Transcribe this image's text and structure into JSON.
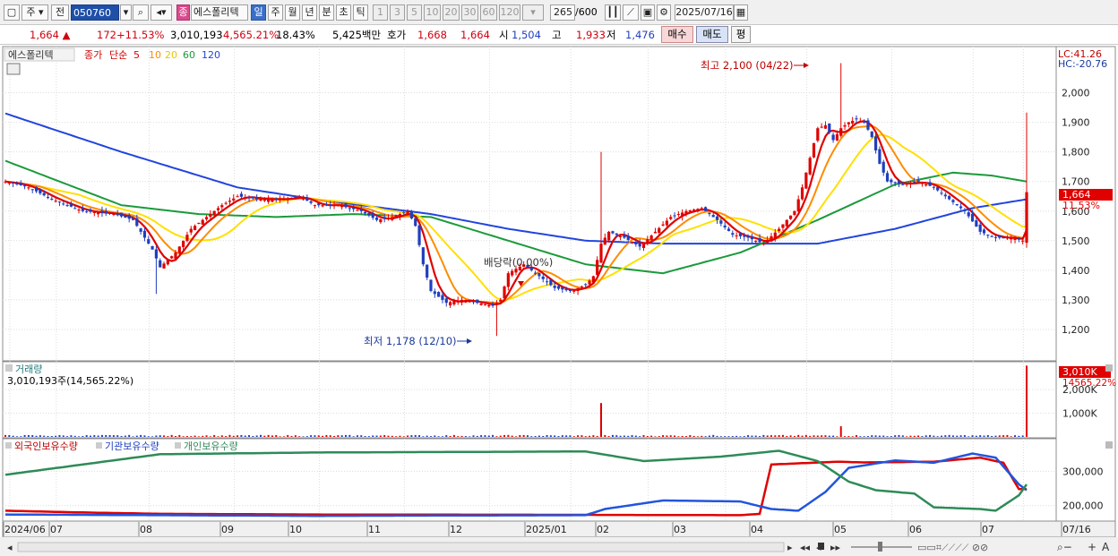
{
  "toolbar": {
    "market_btn": "주",
    "prev_btn": "전",
    "code": "050760",
    "badge": "종",
    "stock_name": "에스폴리텍",
    "periods": [
      "일",
      "주",
      "월",
      "년",
      "분",
      "초",
      "틱"
    ],
    "active_period": "일",
    "counts": [
      "1",
      "3",
      "5",
      "10",
      "20",
      "30",
      "60",
      "120"
    ],
    "bars_shown": "265",
    "bars_total": "/600",
    "date": "2025/07/16"
  },
  "quote": {
    "price": "1,664",
    "change": "172",
    "change_pct": "+11.53%",
    "volume": "3,010,193",
    "vol_ratio": "4,565.21%",
    "turnover": "18.43%",
    "trade_value": "5,425백만",
    "hoga_label": "호가",
    "ask": "1,668",
    "bid": "1,664",
    "open_label": "시",
    "open": "1,504",
    "high_label": "고",
    "high": "1,933",
    "low_label": "저",
    "low": "1,476",
    "buy_btn": "매수",
    "sell_btn": "매도",
    "eval_btn": "평"
  },
  "colors": {
    "ma5": "#e00000",
    "ma10": "#ff8c00",
    "ma20": "#ffe000",
    "ma60": "#1a9a3a",
    "ma120": "#2244dd",
    "up": "#e00000",
    "down": "#1f3fbf",
    "foreign": "#e00000",
    "institution": "#2255dd",
    "individual": "#2e8b57"
  },
  "chart_data": [
    {
      "type": "candlestick",
      "title": "에스폴리텍",
      "legend": {
        "price_label": "종가",
        "method_label": "단순",
        "periods": [
          "5",
          "10",
          "20",
          "60",
          "120"
        ]
      },
      "ylim": [
        1100,
        2150
      ],
      "yticks": [
        "1,200",
        "1,300",
        "1,400",
        "1,500",
        "1,600",
        "1,700",
        "1,800",
        "1,900",
        "2,000"
      ],
      "right_labels": {
        "lc": "LC:41.26",
        "hc": "HC:-20.76",
        "last_price": "1,664",
        "last_pct": "11.53%"
      },
      "annotations": {
        "high": "최고 2,100 (04/22)",
        "low": "최저 1,178 (12/10)",
        "dividend": "배당락(0.00%)"
      },
      "x_labels": [
        "2024/06",
        "07",
        "08",
        "09",
        "10",
        "11",
        "12",
        "2025/01",
        "02",
        "03",
        "04",
        "05",
        "06",
        "07",
        "07/16"
      ],
      "close_anchors": [
        [
          0,
          1700
        ],
        [
          6,
          1680
        ],
        [
          12,
          1640
        ],
        [
          20,
          1600
        ],
        [
          28,
          1590
        ],
        [
          33,
          1570
        ],
        [
          38,
          1470
        ],
        [
          40,
          1410
        ],
        [
          44,
          1460
        ],
        [
          48,
          1540
        ],
        [
          52,
          1580
        ],
        [
          56,
          1620
        ],
        [
          60,
          1650
        ],
        [
          66,
          1640
        ],
        [
          72,
          1640
        ],
        [
          76,
          1650
        ],
        [
          80,
          1620
        ],
        [
          86,
          1620
        ],
        [
          92,
          1600
        ],
        [
          96,
          1570
        ],
        [
          100,
          1580
        ],
        [
          104,
          1600
        ],
        [
          106,
          1550
        ],
        [
          108,
          1420
        ],
        [
          110,
          1330
        ],
        [
          114,
          1290
        ],
        [
          118,
          1300
        ],
        [
          122,
          1290
        ],
        [
          126,
          1280
        ],
        [
          128,
          1300
        ],
        [
          130,
          1390
        ],
        [
          134,
          1420
        ],
        [
          138,
          1380
        ],
        [
          142,
          1340
        ],
        [
          146,
          1330
        ],
        [
          150,
          1350
        ],
        [
          152,
          1380
        ],
        [
          154,
          1490
        ],
        [
          156,
          1530
        ],
        [
          160,
          1510
        ],
        [
          164,
          1480
        ],
        [
          168,
          1530
        ],
        [
          172,
          1580
        ],
        [
          176,
          1600
        ],
        [
          180,
          1610
        ],
        [
          184,
          1570
        ],
        [
          188,
          1520
        ],
        [
          192,
          1510
        ],
        [
          196,
          1490
        ],
        [
          200,
          1540
        ],
        [
          204,
          1600
        ],
        [
          206,
          1680
        ],
        [
          208,
          1780
        ],
        [
          210,
          1880
        ],
        [
          212,
          1890
        ],
        [
          214,
          1840
        ],
        [
          216,
          1880
        ],
        [
          218,
          1900
        ],
        [
          220,
          1910
        ],
        [
          222,
          1900
        ],
        [
          224,
          1850
        ],
        [
          226,
          1760
        ],
        [
          228,
          1700
        ],
        [
          232,
          1690
        ],
        [
          236,
          1700
        ],
        [
          240,
          1680
        ],
        [
          244,
          1640
        ],
        [
          248,
          1600
        ],
        [
          252,
          1530
        ],
        [
          256,
          1510
        ],
        [
          260,
          1510
        ],
        [
          263,
          1500
        ],
        [
          264,
          1664
        ]
      ],
      "ma60_anchors": [
        [
          0,
          1770
        ],
        [
          30,
          1620
        ],
        [
          50,
          1590
        ],
        [
          70,
          1580
        ],
        [
          90,
          1590
        ],
        [
          110,
          1580
        ],
        [
          130,
          1500
        ],
        [
          150,
          1420
        ],
        [
          170,
          1390
        ],
        [
          190,
          1460
        ],
        [
          210,
          1570
        ],
        [
          230,
          1690
        ],
        [
          245,
          1730
        ],
        [
          255,
          1720
        ],
        [
          264,
          1700
        ]
      ],
      "ma120_anchors": [
        [
          0,
          1930
        ],
        [
          30,
          1800
        ],
        [
          60,
          1680
        ],
        [
          80,
          1640
        ],
        [
          110,
          1590
        ],
        [
          130,
          1540
        ],
        [
          150,
          1500
        ],
        [
          170,
          1490
        ],
        [
          190,
          1490
        ],
        [
          210,
          1490
        ],
        [
          230,
          1540
        ],
        [
          250,
          1610
        ],
        [
          264,
          1640
        ]
      ]
    },
    {
      "type": "bar",
      "title": "거래량",
      "summary": "3,010,193주(14,565.22%)",
      "yticks": [
        "1,000K",
        "2,000K"
      ],
      "ylim": [
        0,
        3100000
      ],
      "right_labels": {
        "last_volume": "3,010K",
        "last_pct": "14565.22%"
      },
      "spikes": [
        [
          154,
          1430000
        ],
        [
          216,
          450000
        ],
        [
          264,
          3010193
        ]
      ],
      "base_volume": 60000
    },
    {
      "type": "line",
      "legend": [
        "외국인보유수량",
        "기관보유수량",
        "개인보유수량"
      ],
      "yticks": [
        "200,000",
        "300,000"
      ],
      "ylim": [
        160000,
        390000
      ],
      "series": [
        {
          "name": "외국인보유수량",
          "anchors": [
            [
              0,
              185000
            ],
            [
              20,
              180000
            ],
            [
              40,
              176000
            ],
            [
              80,
              174000
            ],
            [
              150,
              173000
            ],
            [
              190,
              172000
            ],
            [
              195,
              176000
            ],
            [
              198,
              320000
            ],
            [
              215,
              328000
            ],
            [
              222,
              326000
            ],
            [
              240,
              328000
            ],
            [
              252,
              340000
            ],
            [
              258,
              325000
            ],
            [
              262,
              248000
            ],
            [
              264,
              248000
            ]
          ]
        },
        {
          "name": "기관보유수량",
          "anchors": [
            [
              0,
              174000
            ],
            [
              80,
              170000
            ],
            [
              150,
              172000
            ],
            [
              155,
              190000
            ],
            [
              170,
              215000
            ],
            [
              190,
              212000
            ],
            [
              198,
              190000
            ],
            [
              205,
              185000
            ],
            [
              212,
              240000
            ],
            [
              218,
              310000
            ],
            [
              230,
              332000
            ],
            [
              240,
              325000
            ],
            [
              250,
              352000
            ],
            [
              256,
              340000
            ],
            [
              262,
              262000
            ],
            [
              264,
              245000
            ]
          ]
        },
        {
          "name": "개인보유수량",
          "anchors": [
            [
              0,
              290000
            ],
            [
              20,
              320000
            ],
            [
              40,
              350000
            ],
            [
              80,
              355000
            ],
            [
              150,
              358000
            ],
            [
              165,
              330000
            ],
            [
              185,
              343000
            ],
            [
              200,
              360000
            ],
            [
              210,
              330000
            ],
            [
              218,
              270000
            ],
            [
              225,
              245000
            ],
            [
              235,
              235000
            ],
            [
              240,
              195000
            ],
            [
              252,
              190000
            ],
            [
              256,
              185000
            ],
            [
              262,
              230000
            ],
            [
              264,
              262000
            ]
          ]
        }
      ]
    }
  ]
}
